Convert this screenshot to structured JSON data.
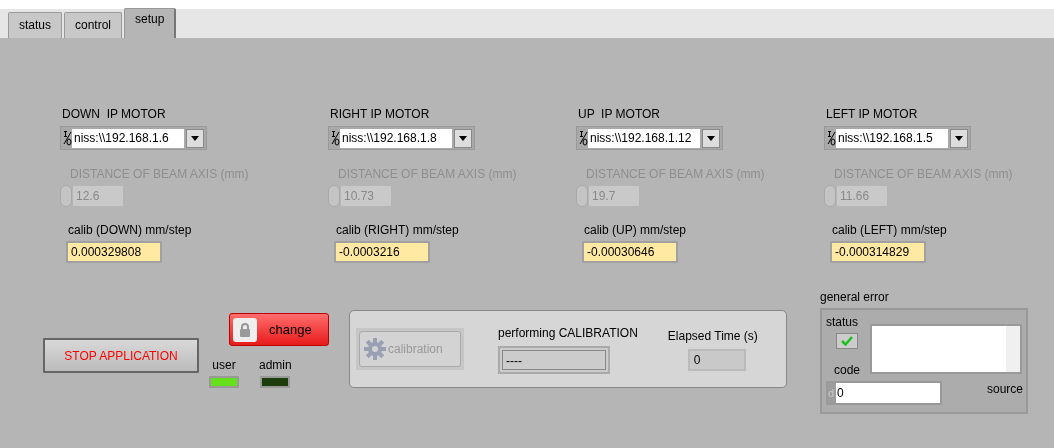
{
  "tabs": [
    {
      "label": "status",
      "selected": false
    },
    {
      "label": "control",
      "selected": false
    },
    {
      "label": "setup",
      "selected": true
    }
  ],
  "motors": [
    {
      "title": "DOWN  IP MOTOR",
      "address": "niss:\\\\192.168.1.6",
      "distance_label": "DISTANCE OF BEAM AXIS (mm)",
      "distance": "12.6",
      "disabled": true,
      "calib_label": "calib (DOWN) mm/step",
      "calib": "0.000329808"
    },
    {
      "title": "RIGHT IP MOTOR",
      "address": "niss:\\\\192.168.1.8",
      "distance_label": "DISTANCE OF BEAM AXIS (mm)",
      "distance": "10.73",
      "disabled": true,
      "calib_label": "calib (RIGHT) mm/step",
      "calib": "-0.0003216"
    },
    {
      "title": "UP  IP MOTOR",
      "address": "niss:\\\\192.168.1.12",
      "distance_label": "DISTANCE OF BEAM AXIS (mm)",
      "distance": "19.7",
      "disabled": true,
      "calib_label": "calib  (UP) mm/step",
      "calib": "-0.00030646"
    },
    {
      "title": "LEFT IP MOTOR",
      "address": "niss:\\\\192.168.1.5",
      "distance_label": "DISTANCE OF BEAM AXIS (mm)",
      "distance": "11.66",
      "disabled": true,
      "calib_label": "calib (LEFT) mm/step",
      "calib": "-0.000314829"
    }
  ],
  "stop_button": "STOP APPLICATION",
  "change_button": "change",
  "leds": [
    {
      "label": "user",
      "on": true
    },
    {
      "label": "admin",
      "on": false
    }
  ],
  "calibration": {
    "button": "calibration",
    "disabled": true,
    "performing_label": "performing CALIBRATION",
    "performing_value": "----",
    "elapsed_label": "Elapsed Time (s)",
    "elapsed_value": "0"
  },
  "general_error": {
    "title": "general error",
    "status_label": "status",
    "status": true,
    "code_label": "code",
    "radix": "d",
    "code": "0",
    "source_label": "source"
  }
}
